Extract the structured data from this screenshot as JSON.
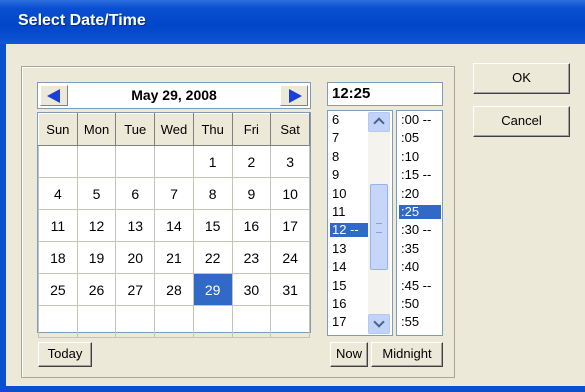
{
  "window": {
    "title": "Select Date/Time"
  },
  "calendar": {
    "title": "May 29, 2008",
    "weekdays": [
      "Sun",
      "Mon",
      "Tue",
      "Wed",
      "Thu",
      "Fri",
      "Sat"
    ],
    "weeks": [
      [
        "",
        "",
        "",
        "",
        "1",
        "2",
        "3"
      ],
      [
        "4",
        "5",
        "6",
        "7",
        "8",
        "9",
        "10"
      ],
      [
        "11",
        "12",
        "13",
        "14",
        "15",
        "16",
        "17"
      ],
      [
        "18",
        "19",
        "20",
        "21",
        "22",
        "23",
        "24"
      ],
      [
        "25",
        "26",
        "27",
        "28",
        "29",
        "30",
        "31"
      ],
      [
        "",
        "",
        "",
        "",
        "",
        "",
        ""
      ]
    ],
    "selected_day": "29",
    "today_label": "Today"
  },
  "time": {
    "display": "12:25",
    "hours": [
      "6",
      "7",
      "8",
      "9",
      "10",
      "11",
      "12 --",
      "13",
      "14",
      "15",
      "16",
      "17"
    ],
    "selected_hour": "12 --",
    "minutes": [
      ":00 --",
      ":05",
      ":10",
      ":15 --",
      ":20",
      ":25",
      ":30 --",
      ":35",
      ":40",
      ":45 --",
      ":50",
      ":55"
    ],
    "selected_minute": ":25",
    "now_label": "Now",
    "midnight_label": "Midnight"
  },
  "buttons": {
    "ok": "OK",
    "cancel": "Cancel"
  },
  "colors": {
    "selection": "#3169c6",
    "titlebar": "#0a4fd0",
    "face": "#ece9d8"
  }
}
